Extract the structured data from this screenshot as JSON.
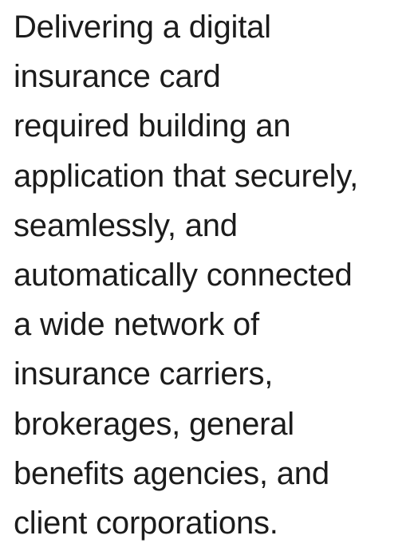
{
  "paragraph": {
    "lines": [
      "Delivering a digital",
      "insurance card",
      "required building an",
      "application that securely,",
      "seamlessly, and",
      "automatically connected",
      "a wide network of",
      "insurance carriers,",
      "brokerages, general",
      "benefits agencies, and",
      "client corporations."
    ]
  }
}
